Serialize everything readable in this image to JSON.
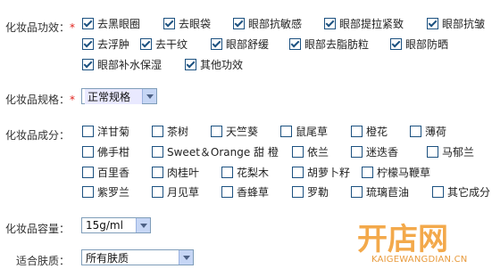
{
  "effects": {
    "label": "化妆品功效：",
    "required_mark": "*",
    "options": [
      {
        "label": "去黑眼圈",
        "checked": true
      },
      {
        "label": "去眼袋",
        "checked": true
      },
      {
        "label": "眼部抗敏感",
        "checked": true
      },
      {
        "label": "眼部提拉紧致",
        "checked": true
      },
      {
        "label": "眼部抗皱",
        "checked": true
      },
      {
        "label": "去浮肿",
        "checked": true
      },
      {
        "label": "去干纹",
        "checked": true
      },
      {
        "label": "眼部舒缓",
        "checked": true
      },
      {
        "label": "眼部去脂肪粒",
        "checked": true
      },
      {
        "label": "眼部防晒",
        "checked": true
      },
      {
        "label": "眼部补水保湿",
        "checked": true
      },
      {
        "label": "其他功效",
        "checked": true
      }
    ]
  },
  "spec": {
    "label": "化妆品规格：",
    "required_mark": "*",
    "value": "正常规格"
  },
  "ingredients": {
    "label": "化妆品成分：",
    "options": [
      {
        "label": "洋甘菊",
        "checked": false
      },
      {
        "label": "茶树",
        "checked": false
      },
      {
        "label": "天竺葵",
        "checked": false
      },
      {
        "label": "鼠尾草",
        "checked": false
      },
      {
        "label": "橙花",
        "checked": false
      },
      {
        "label": "薄荷",
        "checked": false
      },
      {
        "label": "佛手柑",
        "checked": false
      },
      {
        "label": "Sweet＆Orange 甜 橙",
        "checked": false
      },
      {
        "label": "依兰",
        "checked": false
      },
      {
        "label": "迷迭香",
        "checked": false
      },
      {
        "label": "马郁兰",
        "checked": false
      },
      {
        "label": "百里香",
        "checked": false
      },
      {
        "label": "肉桂叶",
        "checked": false
      },
      {
        "label": "花梨木",
        "checked": false
      },
      {
        "label": "胡萝卜籽",
        "checked": false
      },
      {
        "label": "柠檬马鞭草",
        "checked": false
      },
      {
        "label": "紫罗兰",
        "checked": false
      },
      {
        "label": "月见草",
        "checked": false
      },
      {
        "label": "香蜂草",
        "checked": false
      },
      {
        "label": "罗勒",
        "checked": false
      },
      {
        "label": "琉璃苣油",
        "checked": false
      },
      {
        "label": "其它成分",
        "checked": false
      }
    ]
  },
  "capacity": {
    "label": "化妆品容量：",
    "value": "15g/ml"
  },
  "skin": {
    "label": "适合肤质：",
    "value": "所有肤质"
  },
  "watermark": {
    "brand": "开店网",
    "domain": "KAIGEWANGDIAN.CN",
    "color": "#f0a030"
  }
}
